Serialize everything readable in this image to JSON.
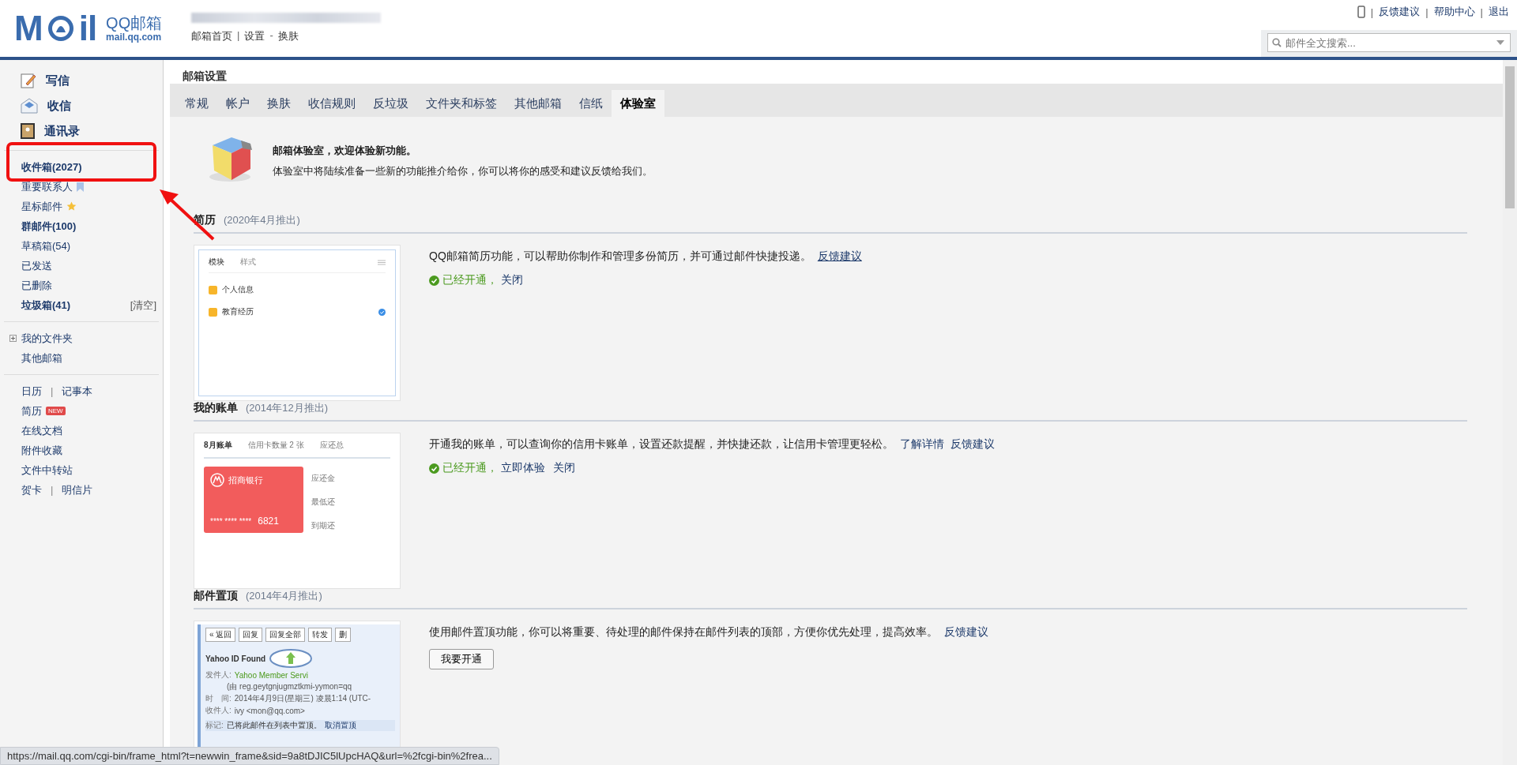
{
  "header": {
    "logo": {
      "left": "M",
      "right": "il",
      "name": "QQ邮箱",
      "domain": "mail.qq.com"
    },
    "nav": [
      {
        "kind": "link",
        "label": "邮箱首页"
      },
      {
        "kind": "sep",
        "label": "|"
      },
      {
        "kind": "link",
        "label": "设置"
      },
      {
        "kind": "sep",
        "label": "-"
      },
      {
        "kind": "link",
        "label": "换肤"
      }
    ],
    "top_links": [
      {
        "kind": "sep",
        "label": "|"
      },
      {
        "kind": "link",
        "label": "反馈建议"
      },
      {
        "kind": "sep",
        "label": "|"
      },
      {
        "kind": "link",
        "label": "帮助中心"
      },
      {
        "kind": "sep",
        "label": "|"
      },
      {
        "kind": "link",
        "label": "退出"
      }
    ],
    "search": {
      "placeholder": "邮件全文搜索..."
    }
  },
  "sidebar": {
    "actions": [
      {
        "kind": "write",
        "label": "写信"
      },
      {
        "kind": "inbox",
        "label": "收信"
      },
      {
        "kind": "contacts",
        "label": "通讯录"
      }
    ],
    "groups": [
      [
        {
          "label": "收件箱(2027)",
          "bold": true
        },
        {
          "label": "重要联系人",
          "bold": false,
          "kind": "bookmark"
        },
        {
          "label": "星标邮件",
          "bold": false,
          "kind": "star"
        },
        {
          "label": "群邮件(100)",
          "bold": true
        },
        {
          "label": "草稿箱(54)",
          "bold": false
        },
        {
          "label": "已发送",
          "bold": false
        },
        {
          "label": "已删除",
          "bold": false
        },
        {
          "label": "垃圾箱(41)",
          "bold": true,
          "extra": "[清空]"
        }
      ],
      [
        {
          "label": "我的文件夹",
          "bold": false,
          "expanded": false
        },
        {
          "label": "其他邮箱",
          "bold": false
        }
      ],
      [
        {
          "label": "日历",
          "bold": false,
          "second": "记事本",
          "sep": "|"
        },
        {
          "label": "简历",
          "bold": false,
          "badge": "NEW"
        },
        {
          "label": "在线文档",
          "bold": false
        },
        {
          "label": "附件收藏",
          "bold": false
        },
        {
          "label": "文件中转站",
          "bold": false
        },
        {
          "label": "贺卡",
          "bold": false,
          "second": "明信片",
          "sep": "|"
        }
      ]
    ]
  },
  "page_title": "邮箱设置",
  "tabs": [
    {
      "label": "常规",
      "selected": false
    },
    {
      "label": "帐户",
      "selected": false
    },
    {
      "label": "换肤",
      "selected": false
    },
    {
      "label": "收信规则",
      "selected": false
    },
    {
      "label": "反垃圾",
      "selected": false
    },
    {
      "label": "文件夹和标签",
      "selected": false
    },
    {
      "label": "其他邮箱",
      "selected": false
    },
    {
      "label": "信纸",
      "selected": false
    },
    {
      "label": "体验室",
      "selected": true
    }
  ],
  "intro": {
    "title": "邮箱体验室，欢迎体验新功能。",
    "text": "体验室中将陆续准备一些新的功能推介给你，你可以将你的感受和建议反馈给我们。"
  },
  "features": [
    {
      "title": "简历",
      "date": "(2020年4月推出)",
      "description": "QQ邮箱简历功能，可以帮助你制作和管理多份简历，并可通过邮件快捷投递。",
      "links": [
        "反馈建议"
      ],
      "enabled": true,
      "status": "已经开通，",
      "actions": [
        "关闭"
      ],
      "thumb": {
        "kind": "resume",
        "tabs": [
          "模块",
          "样式"
        ],
        "rows": [
          "个人信息",
          "教育经历"
        ]
      }
    },
    {
      "title": "我的账单",
      "date": "(2014年12月推出)",
      "description": "开通我的账单，可以查询你的信用卡账单，设置还款提醒，并快捷还款，让信用卡管理更轻松。",
      "links": [
        "了解详情",
        "反馈建议"
      ],
      "enabled": true,
      "status": "已经开通，",
      "actions": [
        "立即体验",
        "关闭"
      ],
      "thumb": {
        "kind": "bill",
        "title": "8月账单",
        "count": "信用卡数量 2 张",
        "total": "应还总",
        "bank": "招商银行",
        "mask": "**** **** ****",
        "last": "6821",
        "side": [
          "应还金",
          "最低还",
          "到期还"
        ]
      }
    },
    {
      "title": "邮件置顶",
      "date": "(2014年4月推出)",
      "description": "使用邮件置顶功能，你可以将重要、待处理的邮件保持在邮件列表的顶部，方便你优先处理，提高效率。",
      "links": [
        "反馈建议"
      ],
      "enabled": false,
      "button": "我要开通",
      "thumb": {
        "kind": "pin",
        "buttons": [
          "« 返回",
          "回复",
          "回复全部",
          "转发",
          "删"
        ],
        "subject": "Yahoo ID Found",
        "rows": [
          {
            "label": "发件人:",
            "value": "Yahoo Member Servi"
          },
          {
            "label": "",
            "value": "(由 reg.geytgnjugmztkmi-yymon=qq"
          },
          {
            "label": "时　间:",
            "value": "2014年4月9日(星期三) 凌晨1:14 (UTC-"
          },
          {
            "label": "收件人:",
            "value": "ivy <mon@qq.com>"
          }
        ],
        "note_label": "标记:",
        "note": "已将此邮件在列表中置顶。",
        "note_link": "取消置顶"
      }
    }
  ],
  "status_url": "https://mail.qq.com/cgi-bin/frame_html?t=newwin_frame&sid=9a8tDJIC5lUpcHAQ&url=%2fcgi-bin%2frea..."
}
